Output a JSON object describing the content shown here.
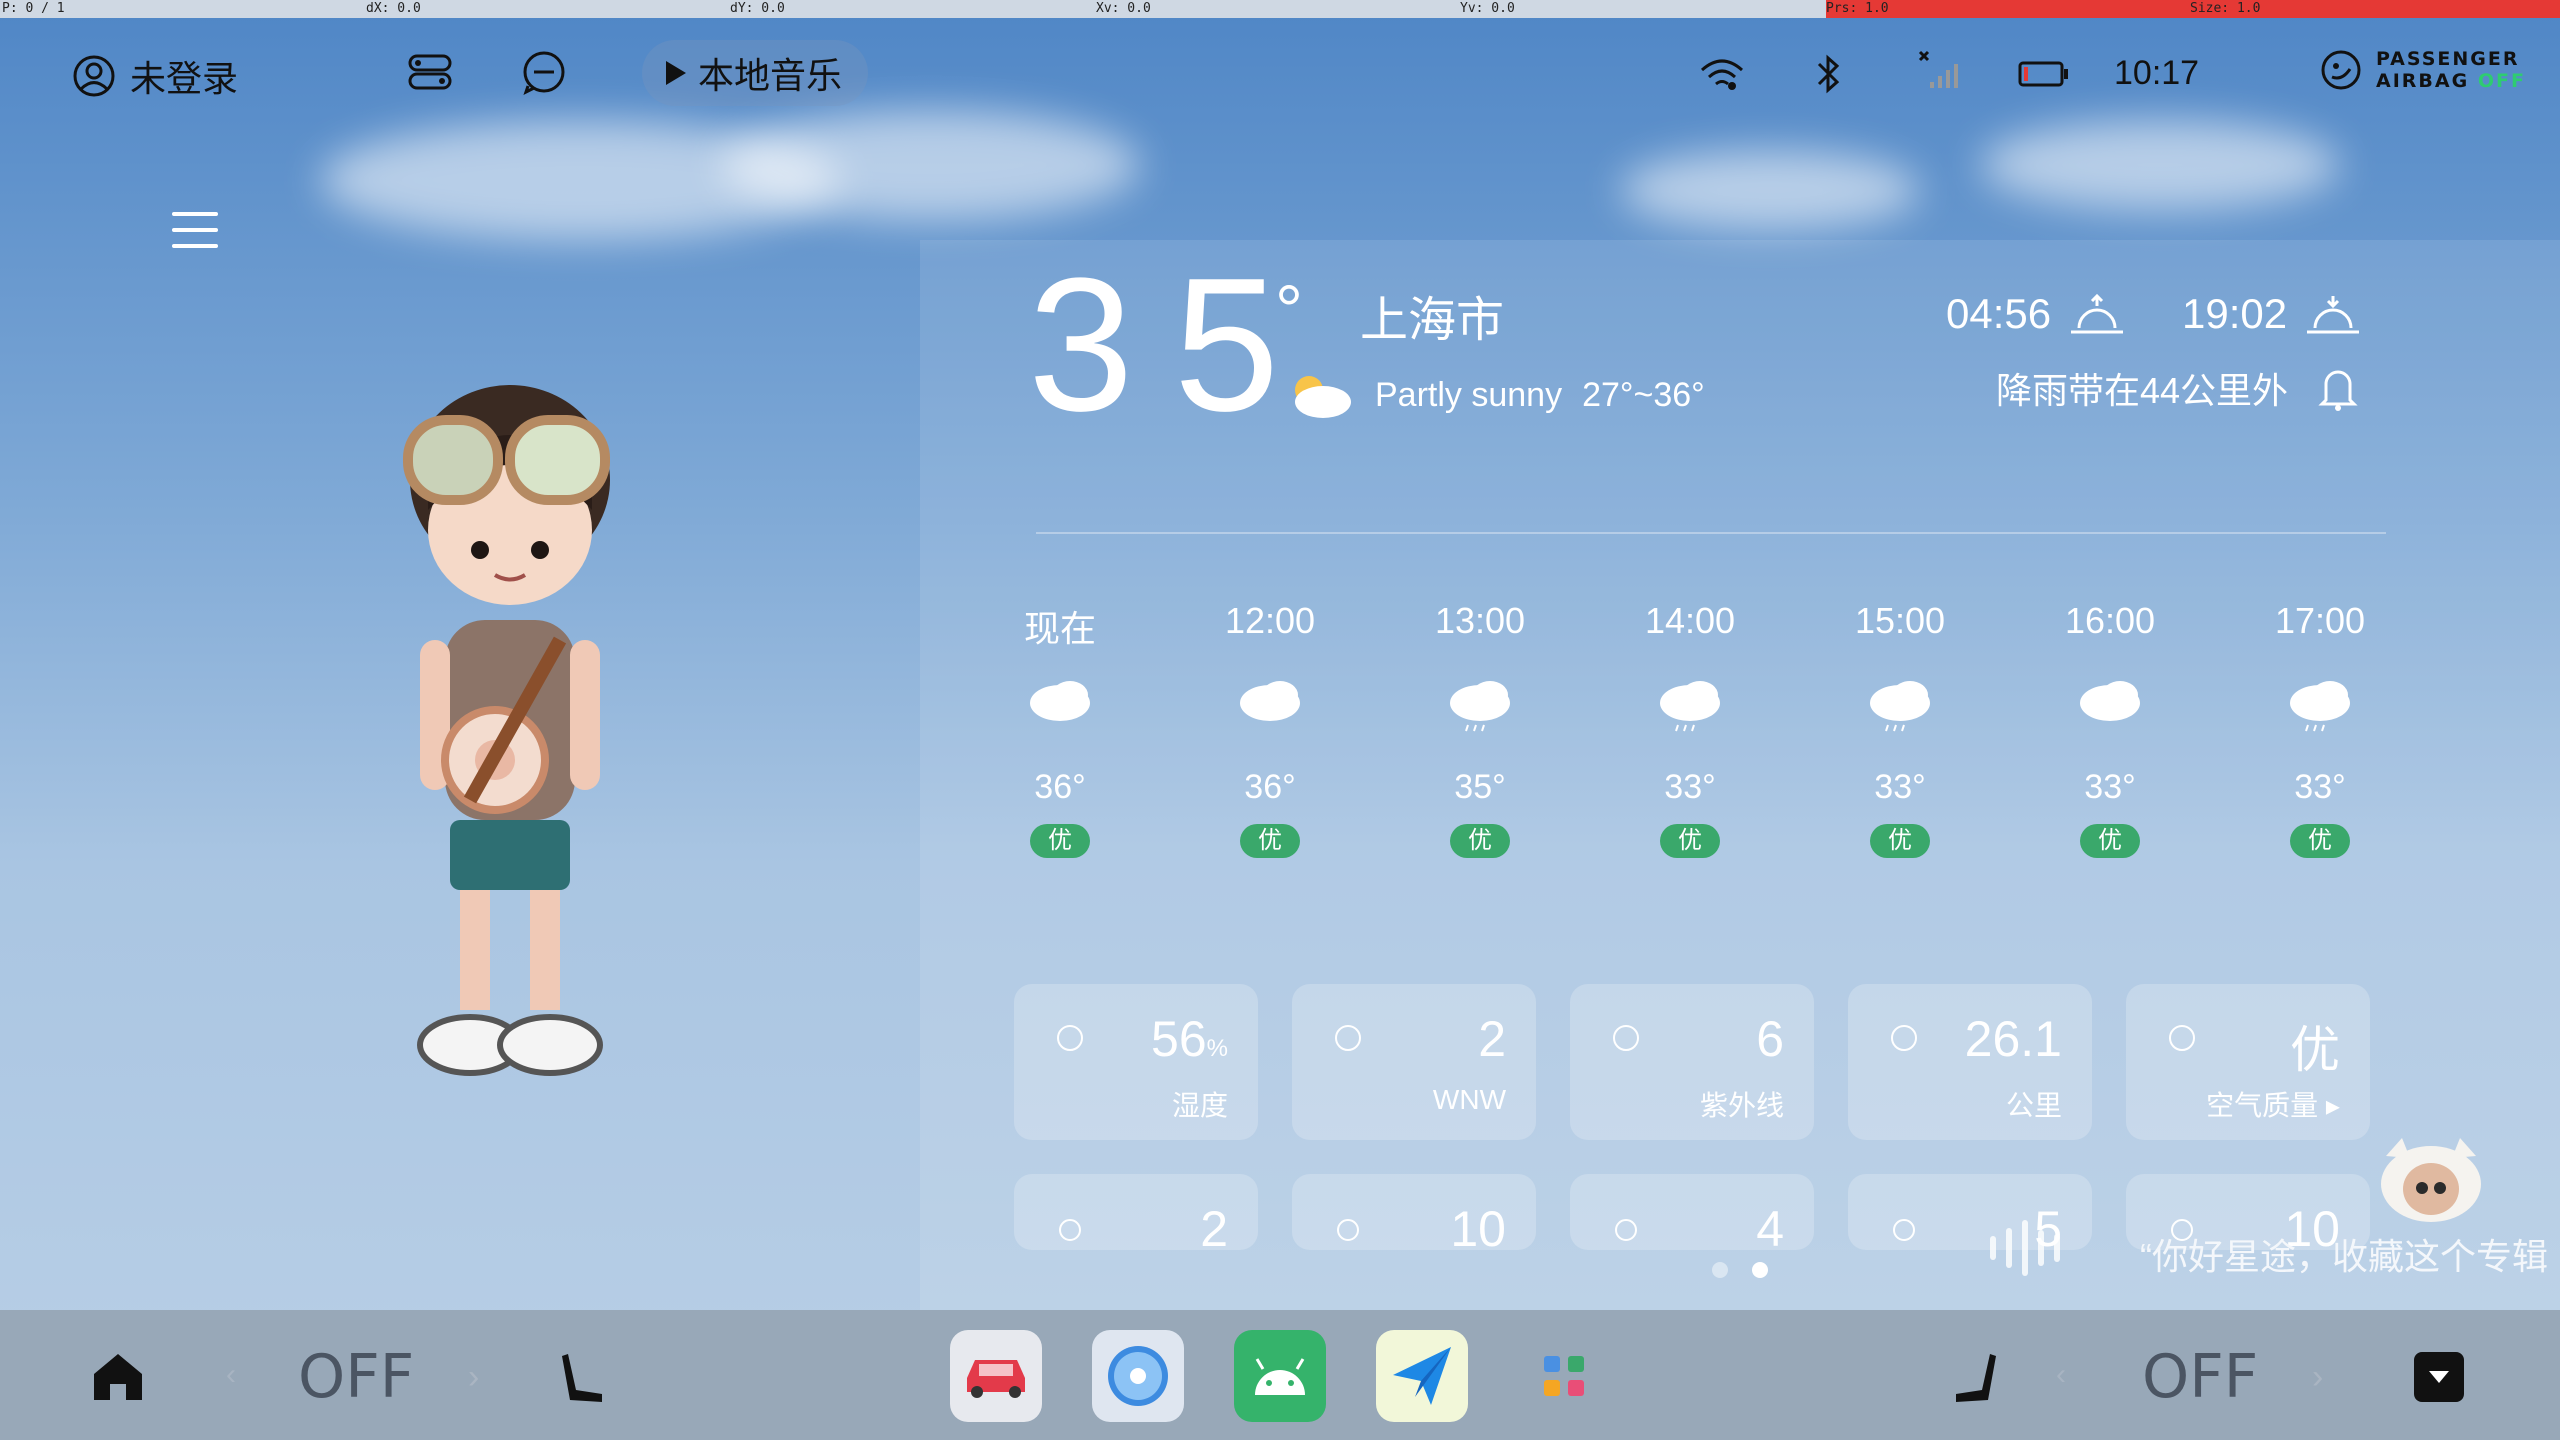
{
  "debug": {
    "p": "P: 0 / 1",
    "dx": "dX: 0.0",
    "dy": "dY: 0.0",
    "xv": "Xv: 0.0",
    "yv": "Yv: 0.0",
    "prs": "Prs: 1.0",
    "size": "Size: 1.0"
  },
  "status": {
    "user": "未登录",
    "music": "本地音乐",
    "time": "10:17",
    "airbag_line1": "PASSENGER",
    "airbag_line2": "AIRBAG",
    "airbag_state": "OFF"
  },
  "weather": {
    "temperature": "35",
    "degree": "°",
    "city": "上海市",
    "condition": "Partly sunny",
    "range": "27°~36°",
    "sunrise": "04:56",
    "sunset": "19:02",
    "rain_alert": "降雨带在44公里外"
  },
  "hourly": [
    {
      "time": "现在",
      "temp": "36°",
      "aq": "优",
      "icon": "cloud-icon"
    },
    {
      "time": "12:00",
      "temp": "36°",
      "aq": "优",
      "icon": "cloud-icon"
    },
    {
      "time": "13:00",
      "temp": "35°",
      "aq": "优",
      "icon": "rain-cloud-icon"
    },
    {
      "time": "14:00",
      "temp": "33°",
      "aq": "优",
      "icon": "rain-cloud-icon"
    },
    {
      "time": "15:00",
      "temp": "33°",
      "aq": "优",
      "icon": "rain-cloud-icon"
    },
    {
      "time": "16:00",
      "temp": "33°",
      "aq": "优",
      "icon": "cloud-icon"
    },
    {
      "time": "17:00",
      "temp": "33°",
      "aq": "优",
      "icon": "rain-cloud-icon"
    }
  ],
  "details": [
    {
      "value": "56",
      "unit": "%",
      "label": "湿度",
      "icon": "thermometer-icon"
    },
    {
      "value": "2",
      "unit": "",
      "label": "WNW",
      "icon": "wind-icon"
    },
    {
      "value": "6",
      "unit": "",
      "label": "紫外线",
      "icon": "uv-sun-icon"
    },
    {
      "value": "26.1",
      "unit": "",
      "label": "公里",
      "icon": "visibility-eye-icon"
    },
    {
      "value": "优",
      "unit": "",
      "label": "空气质量 ▸",
      "icon": "leaf-icon"
    }
  ],
  "details_row2": [
    {
      "value": "2",
      "icon": "drop-icon"
    },
    {
      "value": "10",
      "icon": "car-wash-icon"
    },
    {
      "value": "4",
      "icon": "pill-icon"
    },
    {
      "value": "5",
      "icon": "fish-icon"
    },
    {
      "value": "10",
      "icon": "run-icon"
    }
  ],
  "voice": {
    "text": "“你好星途，收藏这个专辑"
  },
  "dock": {
    "left_state": "OFF",
    "right_state": "OFF"
  },
  "colors": {
    "aq_good": "#3aa86b",
    "dock_bg": "#98a8b8",
    "debug_red": "#e53935"
  }
}
